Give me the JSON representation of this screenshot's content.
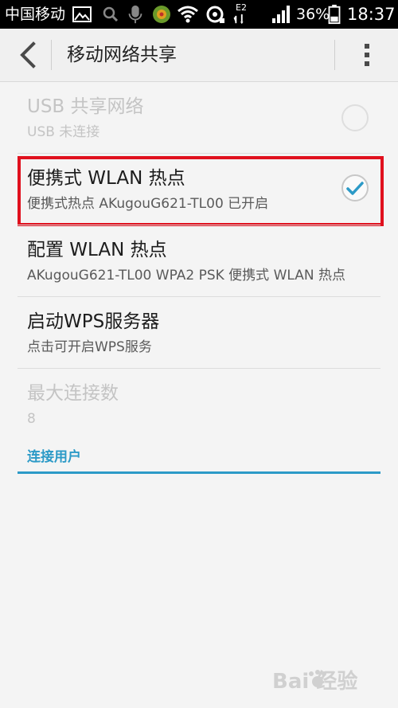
{
  "status_bar": {
    "carrier": "中国移动",
    "network_type": "E2",
    "battery_percent": "36%",
    "time": "18:37",
    "icons": [
      "image-icon",
      "search-icon",
      "mic-icon",
      "app-icon",
      "wifi-icon",
      "sync-icon",
      "signal-icon",
      "battery-icon"
    ]
  },
  "app_bar": {
    "title": "移动网络共享",
    "back_icon": "back-arrow-icon",
    "menu_icon": "overflow-menu-icon"
  },
  "settings": [
    {
      "title": "USB 共享网络",
      "subtitle": "USB 未连接",
      "enabled": false,
      "control": "checkbox",
      "checked": false
    },
    {
      "title": "便携式 WLAN 热点",
      "subtitle": "便携式热点 AKugouG621-TL00 已开启",
      "enabled": true,
      "control": "checkbox",
      "checked": true
    },
    {
      "title": "配置 WLAN 热点",
      "subtitle": "AKugouG621-TL00 WPA2 PSK 便携式 WLAN 热点",
      "enabled": true
    },
    {
      "title": "启动WPS服务器",
      "subtitle": "点击可开启WPS服务",
      "enabled": true
    },
    {
      "title": "最大连接数",
      "subtitle": "8",
      "enabled": false
    }
  ],
  "section_header": "连接用户",
  "colors": {
    "accent": "#2c9ac7",
    "highlight_border": "#e0101d",
    "status_bar": "#000000",
    "background": "#f4f4f4"
  },
  "watermark": {
    "text": "Bai 经验"
  }
}
